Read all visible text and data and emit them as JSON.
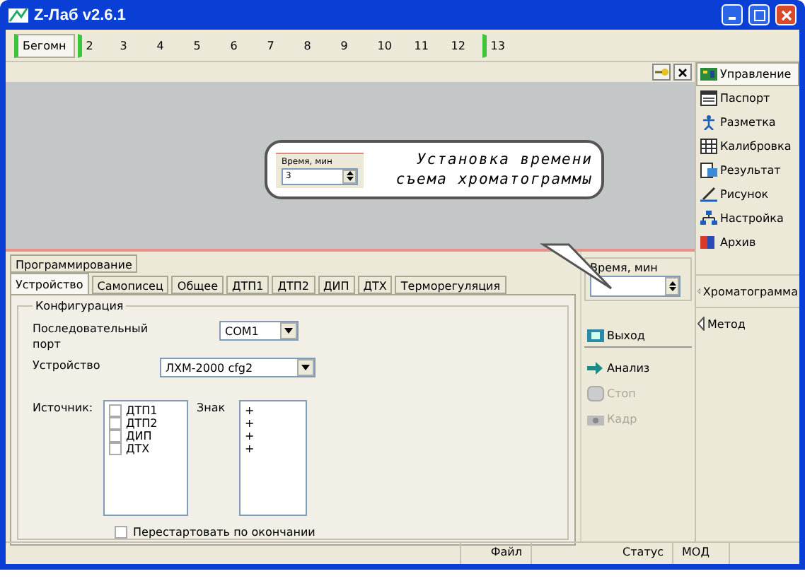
{
  "window": {
    "title": "Z-Лаб v2.6.1"
  },
  "top_tabs": [
    {
      "label": "Бегомн",
      "selected": true,
      "marked": true
    },
    {
      "label": "2",
      "selected": false,
      "marked": true
    },
    {
      "label": "3",
      "selected": false,
      "marked": false
    },
    {
      "label": "4",
      "selected": false,
      "marked": false
    },
    {
      "label": "5",
      "selected": false,
      "marked": false
    },
    {
      "label": "6",
      "selected": false,
      "marked": false
    },
    {
      "label": "7",
      "selected": false,
      "marked": false
    },
    {
      "label": "8",
      "selected": false,
      "marked": false
    },
    {
      "label": "9",
      "selected": false,
      "marked": false
    },
    {
      "label": "10",
      "selected": false,
      "marked": false
    },
    {
      "label": "11",
      "selected": false,
      "marked": false
    },
    {
      "label": "12",
      "selected": false,
      "marked": false
    },
    {
      "label": "13",
      "selected": false,
      "marked": true
    }
  ],
  "callout": {
    "lines": [
      "Установка времени",
      "съема хроматограммы"
    ],
    "spinner": {
      "label": "Время, мин",
      "value": "3"
    }
  },
  "sidebar": {
    "items": [
      {
        "label": "Управление",
        "selected": true
      },
      {
        "label": "Паспорт",
        "selected": false
      },
      {
        "label": "Разметка",
        "selected": false
      },
      {
        "label": "Калибровка",
        "selected": false
      },
      {
        "label": "Результат",
        "selected": false
      },
      {
        "label": "Рисунок",
        "selected": false
      },
      {
        "label": "Настройка",
        "selected": false
      },
      {
        "label": "Архив",
        "selected": false
      }
    ],
    "sections": [
      {
        "label": "Хроматограмма"
      },
      {
        "label": "Метод"
      }
    ]
  },
  "settings": {
    "upper_tabs": [
      {
        "label": "Программирование",
        "selected": false
      }
    ],
    "tabs": [
      {
        "label": "Устройство",
        "selected": true
      },
      {
        "label": "Самописец",
        "selected": false
      },
      {
        "label": "Общее",
        "selected": false
      },
      {
        "label": "ДТП1",
        "selected": false
      },
      {
        "label": "ДТП2",
        "selected": false
      },
      {
        "label": "ДИП",
        "selected": false
      },
      {
        "label": "ДТХ",
        "selected": false
      },
      {
        "label": "Терморегуляция",
        "selected": false
      }
    ],
    "group_title": "Конфигурация",
    "fields": [
      {
        "label": "Последовательный порт",
        "value": "COM1"
      },
      {
        "label": "Устройство",
        "value": "ЛХМ-2000 cfg2"
      }
    ],
    "source_label": "Источник:",
    "sources": [
      {
        "label": "ДТП1",
        "checked": false
      },
      {
        "label": "ДТП2",
        "checked": false
      },
      {
        "label": "ДИП",
        "checked": false
      },
      {
        "label": "ДТХ",
        "checked": false
      }
    ],
    "sign_label": "Знак",
    "signs": [
      "+",
      "+",
      "+",
      "+"
    ],
    "restart": {
      "label": "Перестартовать по окончании",
      "checked": false
    }
  },
  "time_spinner": {
    "label": "Время, мин"
  },
  "actions": [
    {
      "label": "Выход",
      "disabled": false
    },
    {
      "label": "Анализ",
      "disabled": false
    },
    {
      "label": "Стоп",
      "disabled": true
    },
    {
      "label": "Кадр",
      "disabled": true
    }
  ],
  "status_bar": [
    {
      "text": "Файл"
    },
    {
      "text": "Статус"
    },
    {
      "text": "МОД"
    }
  ]
}
